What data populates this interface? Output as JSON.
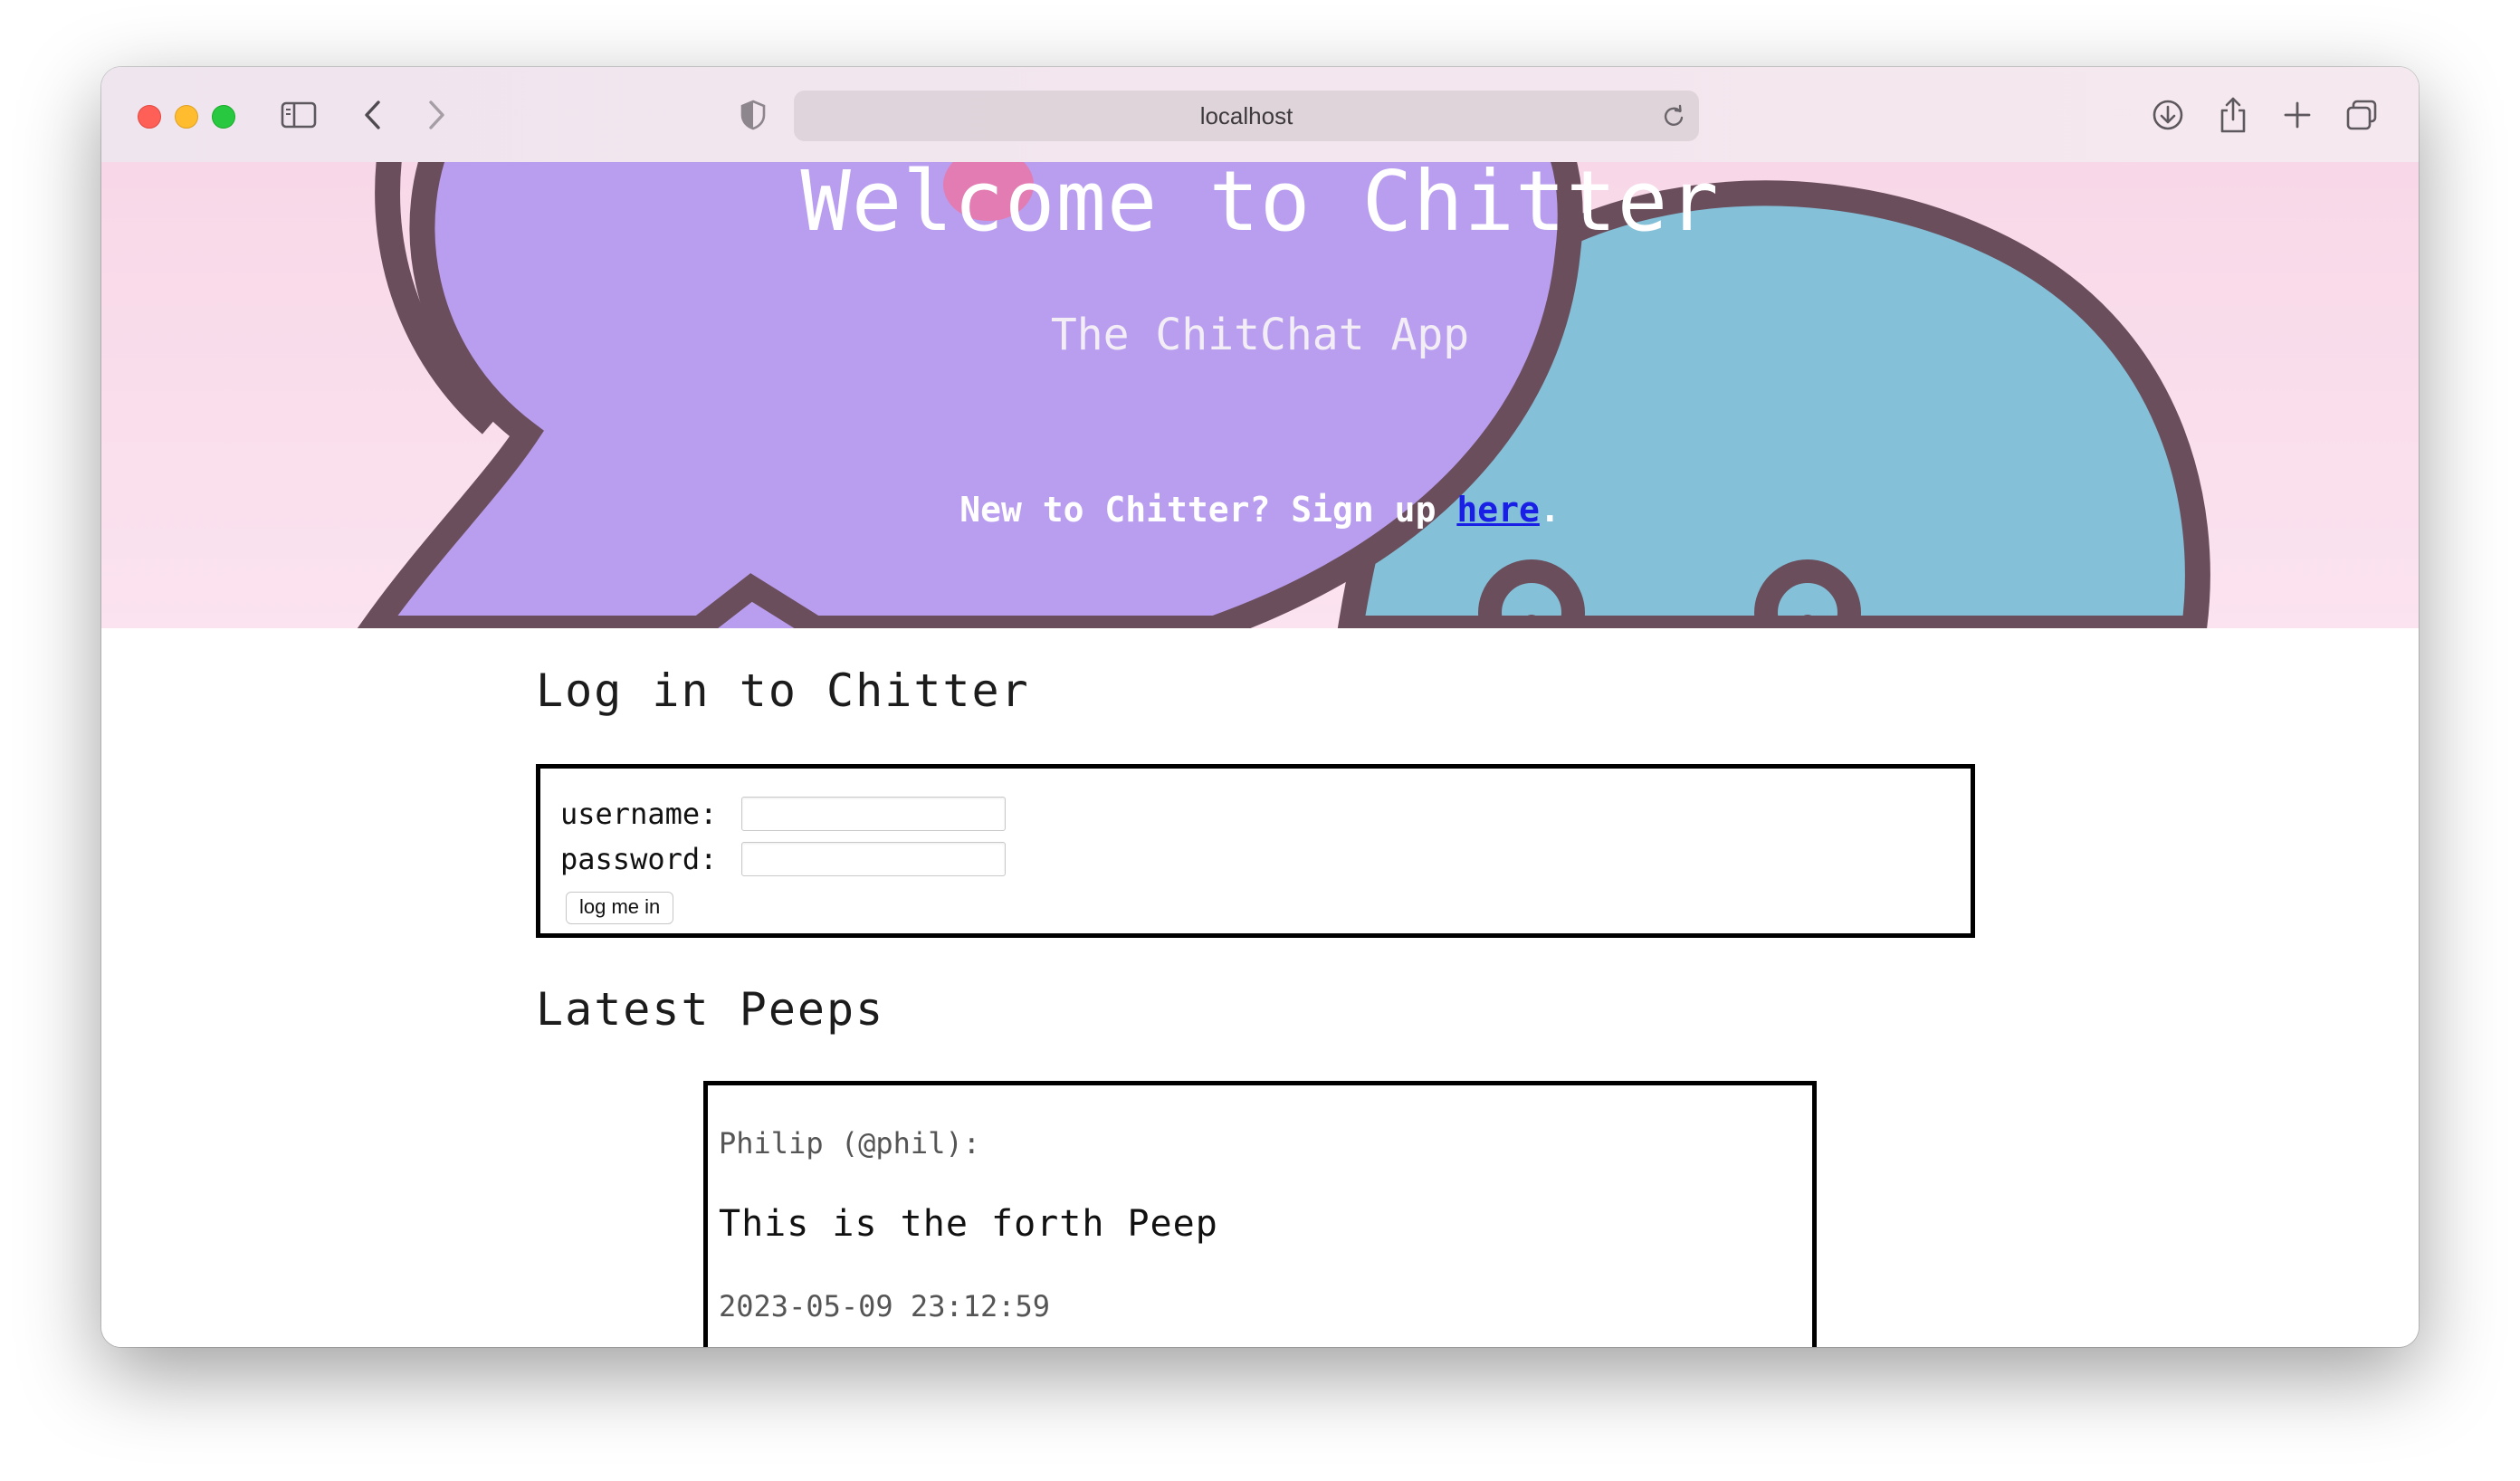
{
  "browser": {
    "url": "localhost"
  },
  "hero": {
    "title": "Welcome to Chitter",
    "subtitle": "The ChitChat App",
    "signup_prefix": "New to Chitter? Sign up ",
    "signup_link": "here",
    "signup_suffix": "."
  },
  "login": {
    "heading": "Log in to Chitter",
    "username_label": "username:",
    "username_value": "",
    "password_label": "password:",
    "password_value": "",
    "submit_label": "log me in"
  },
  "peeps": {
    "heading": "Latest Peeps",
    "items": [
      {
        "author": "Philip (@phil):",
        "body": "This is the forth Peep",
        "timestamp": "2023-05-09 23:12:59"
      }
    ]
  },
  "colors": {
    "hero_background": "#f8d8e8",
    "bubble_purple": "#b99ef0",
    "bubble_blue": "#84c1d9",
    "outline": "#6b4e5c",
    "link": "#1a1fe6"
  }
}
